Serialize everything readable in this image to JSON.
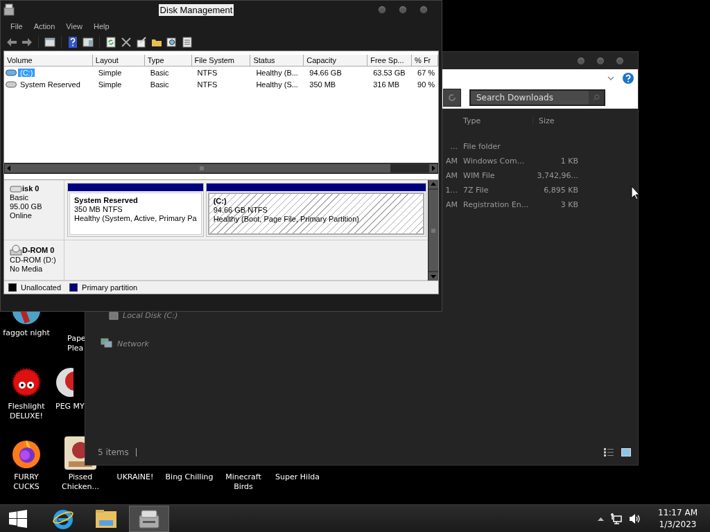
{
  "desktop_icons": [
    {
      "label": "faggot night",
      "kind": "globe"
    },
    {
      "label": "Pape Plea",
      "kind": "hidden"
    },
    {
      "label": "Fleshlight DELUXE!",
      "kind": "fuzzball"
    },
    {
      "label": "PEG MY",
      "kind": "ball"
    },
    {
      "label": "FURRY CUCKS",
      "kind": "firefox"
    },
    {
      "label": "Pissed Chicken...",
      "kind": "game"
    },
    {
      "label": "UKRAINE!",
      "kind": "hidden"
    },
    {
      "label": "Bing Chilling",
      "kind": "hidden"
    },
    {
      "label": "Minecraft Birds",
      "kind": "hidden"
    },
    {
      "label": "Super Hilda",
      "kind": "hidden"
    }
  ],
  "explorer": {
    "search": {
      "placeholder": "Search Downloads"
    },
    "columns": [
      "Type",
      "Size"
    ],
    "rows": [
      {
        "column_1": "...",
        "type": "File folder",
        "size": ""
      },
      {
        "column_1": "AM",
        "type": "Windows Com...",
        "size": "1 KB"
      },
      {
        "column_1": "AM",
        "type": "WIM File",
        "size": "3,742,96..."
      },
      {
        "column_1": "1...",
        "type": "7Z File",
        "size": "6,895 KB"
      },
      {
        "column_1": "AM",
        "type": "Registration En...",
        "size": "3 KB"
      }
    ],
    "nav": [
      {
        "label": "Local Disk (C:)",
        "kind": "disk"
      },
      {
        "label": "Network",
        "kind": "network"
      }
    ],
    "status": "5 items"
  },
  "disk_management": {
    "title": "Disk Management",
    "menu": [
      "File",
      "Action",
      "View",
      "Help"
    ],
    "columns": [
      "Volume",
      "Layout",
      "Type",
      "File System",
      "Status",
      "Capacity",
      "Free Sp...",
      "% Fr"
    ],
    "rows": [
      {
        "kind": "boot",
        "selected": true,
        "cells": [
          "(C:)",
          "Simple",
          "Basic",
          "NTFS",
          "Healthy (B...",
          "94.66 GB",
          "63.53 GB",
          "67 %"
        ]
      },
      {
        "kind": "plain",
        "selected": false,
        "cells": [
          "System Reserved",
          "Simple",
          "Basic",
          "NTFS",
          "Healthy (S...",
          "350 MB",
          "316 MB",
          "90 %"
        ]
      }
    ],
    "disks": [
      {
        "kind": "disk",
        "name": "isk 0",
        "lines": [
          "Basic",
          "95.00 GB",
          "Online"
        ],
        "partitions": [
          {
            "name": "System Reserved",
            "size": "350 MB NTFS",
            "status": "Healthy (System, Active, Primary Pa",
            "selected": false
          },
          {
            "name": "(C:)",
            "size": "94.66 GB NTFS",
            "status": "Healthy (Boot, Page File, Primary Partition)",
            "selected": true
          }
        ]
      },
      {
        "kind": "cdrom",
        "name": "D-ROM 0",
        "lines": [
          "CD-ROM (D:)",
          "No Media"
        ]
      }
    ],
    "legend": [
      {
        "label": "Unallocated",
        "color": "#000000"
      },
      {
        "label": "Primary partition",
        "color": "#000080"
      }
    ]
  },
  "taskbar": {
    "apps": [
      {
        "kind": "ie",
        "active": false
      },
      {
        "kind": "folder",
        "active": false
      },
      {
        "kind": "diskmgmt",
        "active": true
      }
    ],
    "clock": {
      "time": "11:17 AM",
      "date": "1/3/2023"
    }
  }
}
